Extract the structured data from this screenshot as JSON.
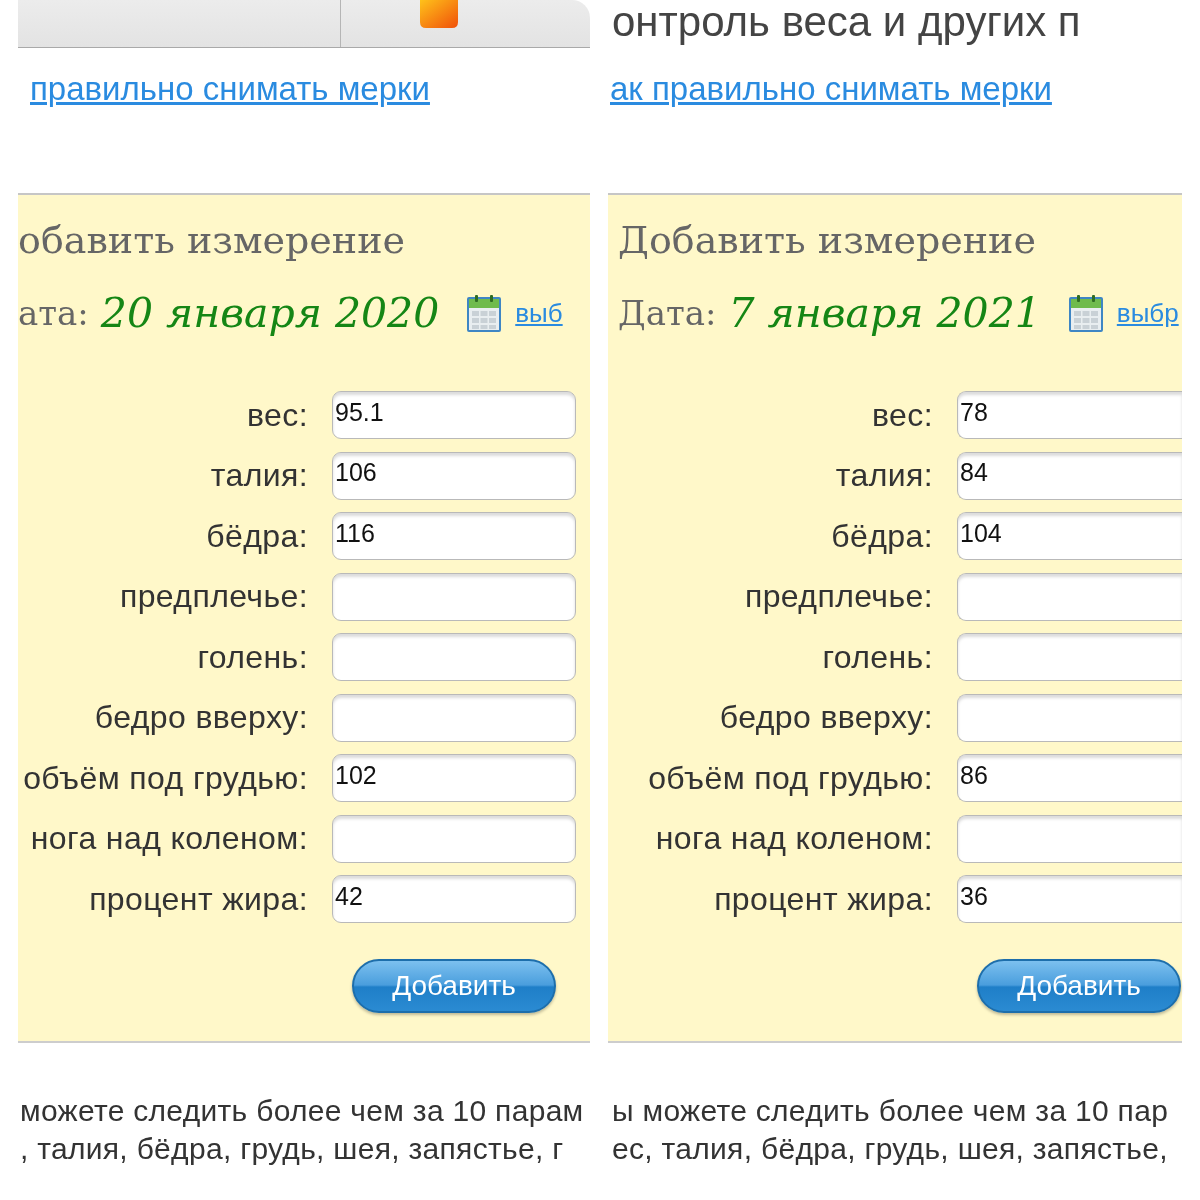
{
  "screenshots": [
    {
      "top": {
        "kind": "tab_bar"
      },
      "help_link": "правильно снимать мерки",
      "form": {
        "title": "обавить измерение",
        "date_label": "ата:",
        "date_value": "20 января 2020",
        "date_link": "выб",
        "fields": [
          {
            "label": "вес:",
            "value": "95.1"
          },
          {
            "label": "талия:",
            "value": "106"
          },
          {
            "label": "бёдра:",
            "value": "116"
          },
          {
            "label": "предплечье:"
          },
          {
            "label": "голень:"
          },
          {
            "label": "бедро вверху:"
          },
          {
            "label": "объём под грудью:",
            "value": "102"
          },
          {
            "label": "нога над коленом:"
          },
          {
            "label": "процент жира:",
            "value": "42"
          }
        ],
        "submit_button": "Добавить"
      },
      "description_lines": [
        "можете следить более чем за 10 парам",
        ", талия, бёдра, грудь, шея, запястье, г"
      ]
    },
    {
      "top": {
        "kind": "heading",
        "text": "онтроль веса и других п"
      },
      "help_link": "ак правильно снимать мерки",
      "form": {
        "title": "Добавить измерение",
        "date_label": "Дата:",
        "date_value": "7 января 2021",
        "date_link": "выбр",
        "fields": [
          {
            "label": "вес:",
            "value": "78"
          },
          {
            "label": "талия:",
            "value": "84"
          },
          {
            "label": "бёдра:",
            "value": "104"
          },
          {
            "label": "предплечье:"
          },
          {
            "label": "голень:"
          },
          {
            "label": "бедро вверху:"
          },
          {
            "label": "объём под грудью:",
            "value": "86"
          },
          {
            "label": "нога над коленом:"
          },
          {
            "label": "процент жира:",
            "value": "36"
          }
        ],
        "submit_button": "Добавить"
      },
      "description_lines": [
        "ы можете следить более чем за 10 пар",
        "ес, талия, бёдра, грудь, шея, запястье,"
      ]
    }
  ]
}
